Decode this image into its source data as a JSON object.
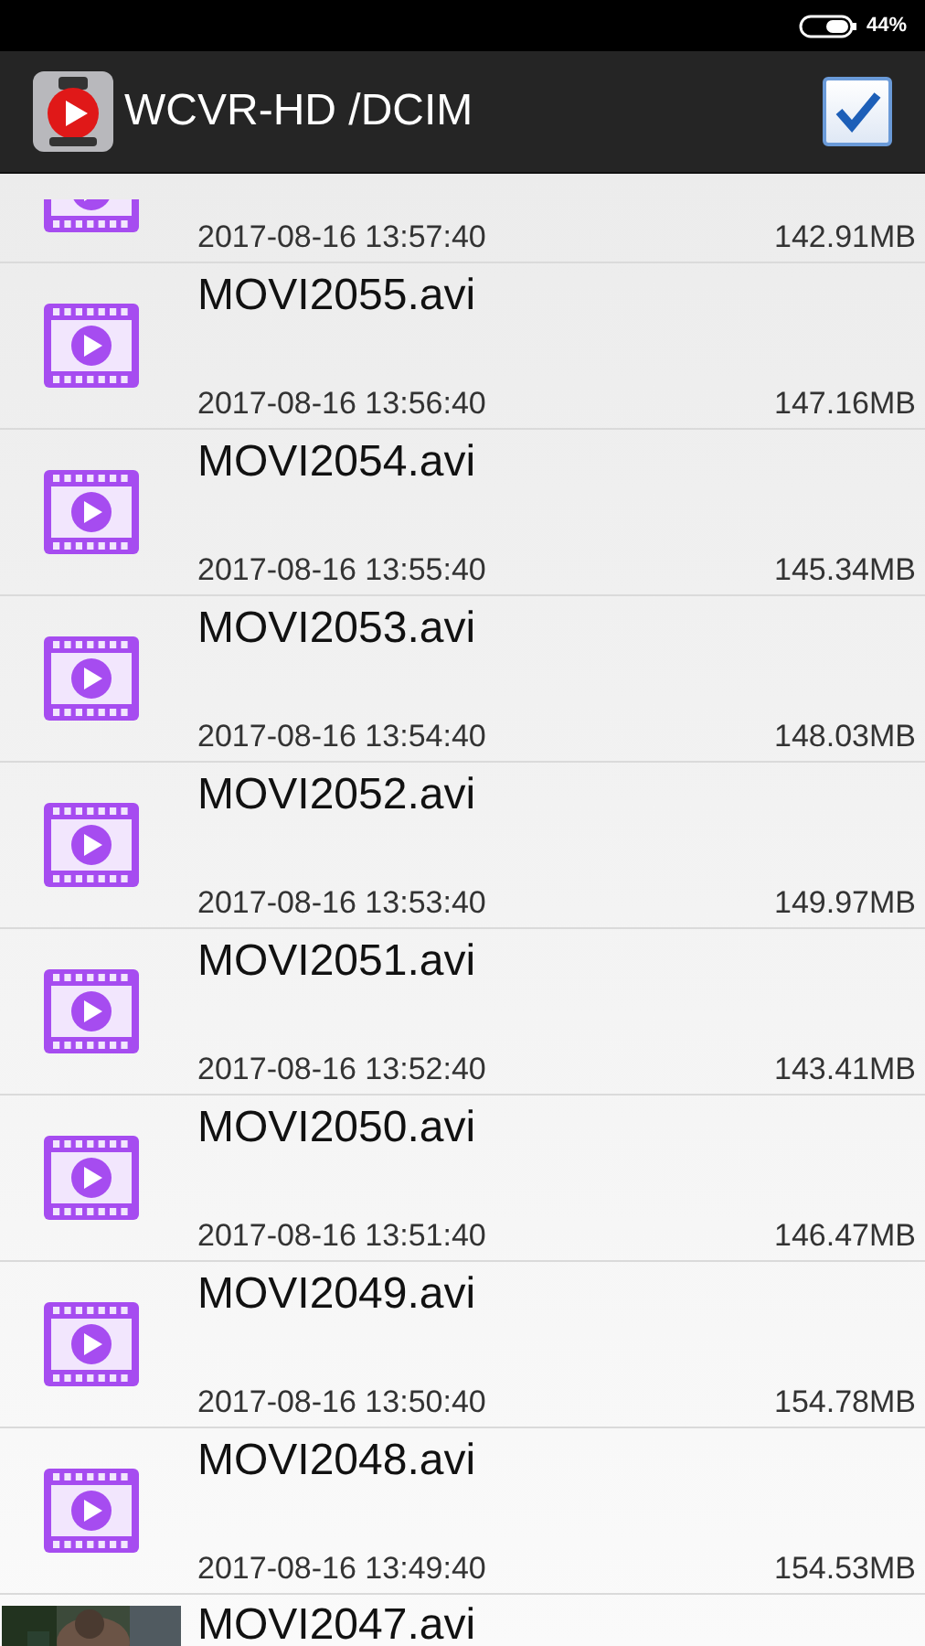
{
  "status_bar": {
    "battery": "44%"
  },
  "app_bar": {
    "title": "WCVR-HD /DCIM",
    "select_all": {
      "checked": true
    }
  },
  "files": [
    {
      "kind": "partial",
      "date": "2017-08-16 13:57:40",
      "size": "142.91MB"
    },
    {
      "kind": "video",
      "name": "MOVI2055.avi",
      "date": "2017-08-16 13:56:40",
      "size": "147.16MB"
    },
    {
      "kind": "video",
      "name": "MOVI2054.avi",
      "date": "2017-08-16 13:55:40",
      "size": "145.34MB"
    },
    {
      "kind": "video",
      "name": "MOVI2053.avi",
      "date": "2017-08-16 13:54:40",
      "size": "148.03MB"
    },
    {
      "kind": "video",
      "name": "MOVI2052.avi",
      "date": "2017-08-16 13:53:40",
      "size": "149.97MB"
    },
    {
      "kind": "video",
      "name": "MOVI2051.avi",
      "date": "2017-08-16 13:52:40",
      "size": "143.41MB"
    },
    {
      "kind": "video",
      "name": "MOVI2050.avi",
      "date": "2017-08-16 13:51:40",
      "size": "146.47MB"
    },
    {
      "kind": "video",
      "name": "MOVI2049.avi",
      "date": "2017-08-16 13:50:40",
      "size": "154.78MB"
    },
    {
      "kind": "video",
      "name": "MOVI2048.avi",
      "date": "2017-08-16 13:49:40",
      "size": "154.53MB"
    },
    {
      "kind": "picture",
      "name": "MOVI2047.avi"
    }
  ]
}
